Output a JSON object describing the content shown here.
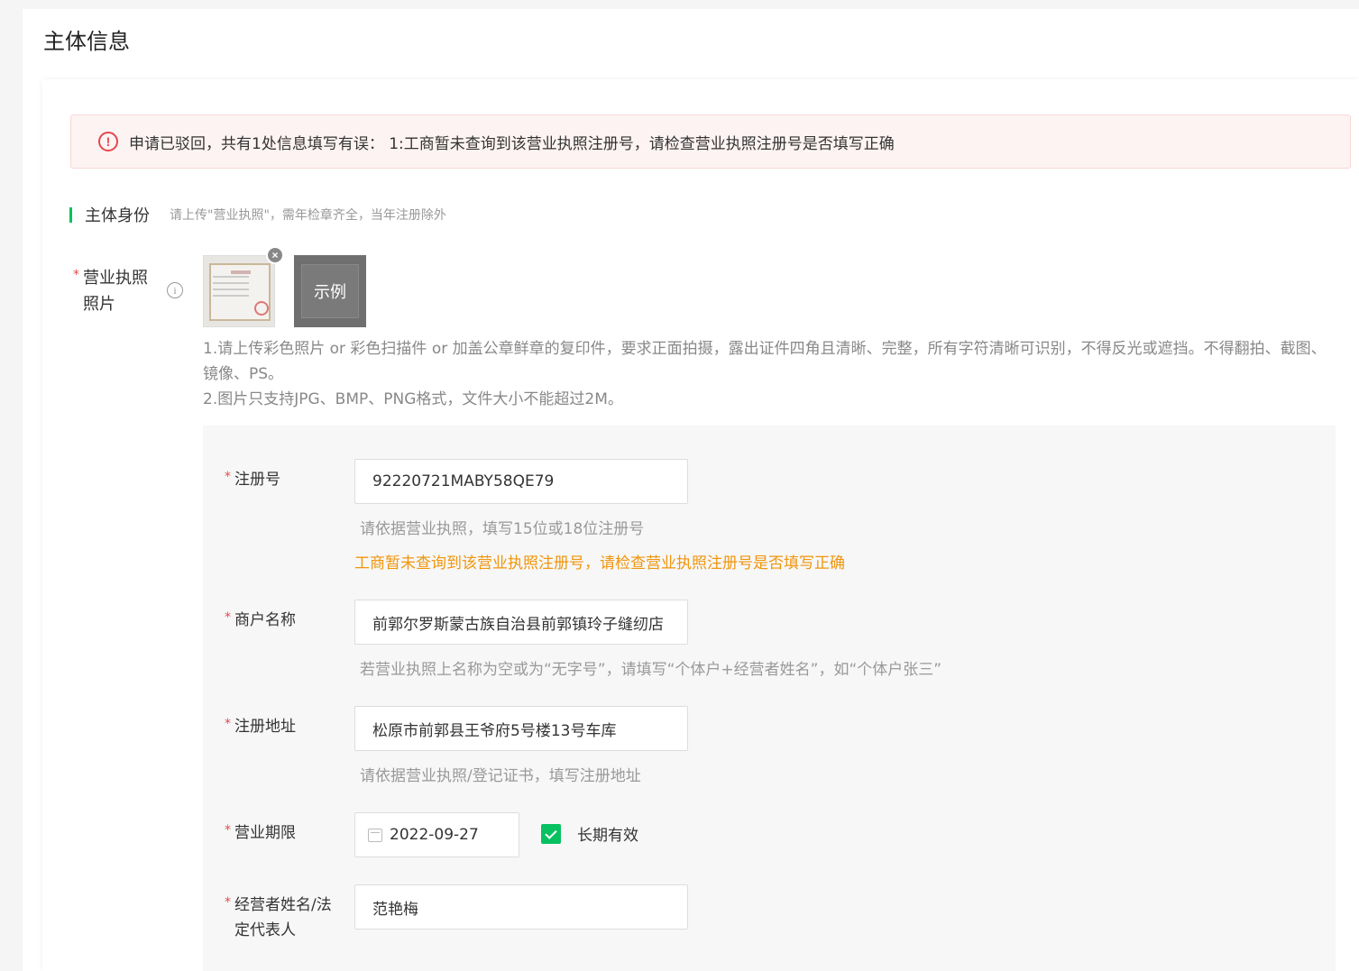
{
  "page": {
    "title": "主体信息"
  },
  "alert": {
    "icon": "alert-circle-icon",
    "message": "申请已驳回，共有1处信息填写有误： 1:工商暂未查询到该营业执照注册号，请检查营业执照注册号是否填写正确"
  },
  "section": {
    "title": "主体身份",
    "subtitle": "请上传\"营业执照\"，需年检章齐全，当年注册除外"
  },
  "license": {
    "label_line1": "营业执照",
    "label_line2": "照片",
    "required_mark": "*",
    "example_label": "示例",
    "tip_line1": "1.请上传彩色照片 or 彩色扫描件 or 加盖公章鲜章的复印件，要求正面拍摄，露出证件四角且清晰、完整，所有字符清晰可识别，不得反光或遮挡。不得翻拍、截图、镜像、PS。",
    "tip_line2": "2.图片只支持JPG、BMP、PNG格式，文件大小不能超过2M。"
  },
  "form": {
    "reg_no": {
      "label": "注册号",
      "value": "92220721MABY58QE79",
      "hint": "请依据营业执照，填写15位或18位注册号",
      "error": "工商暂未查询到该营业执照注册号，请检查营业执照注册号是否填写正确"
    },
    "merchant_name": {
      "label": "商户名称",
      "value": "前郭尔罗斯蒙古族自治县前郭镇玲子缝纫店",
      "hint": "若营业执照上名称为空或为“无字号”，请填写“个体户+经营者姓名”，如“个体户张三”"
    },
    "address": {
      "label": "注册地址",
      "value": "松原市前郭县王爷府5号楼13号车库",
      "hint": "请依据营业执照/登记证书，填写注册地址"
    },
    "term": {
      "label": "营业期限",
      "value": "2022-09-27",
      "long_term_label": "长期有效",
      "long_term_checked": true
    },
    "legal_rep": {
      "label_line1": "经营者姓名/法",
      "label_line2": "定代表人",
      "value": "范艳梅"
    }
  },
  "colors": {
    "accent": "#07c160",
    "error": "#e5484d",
    "warning": "#f0950c"
  }
}
